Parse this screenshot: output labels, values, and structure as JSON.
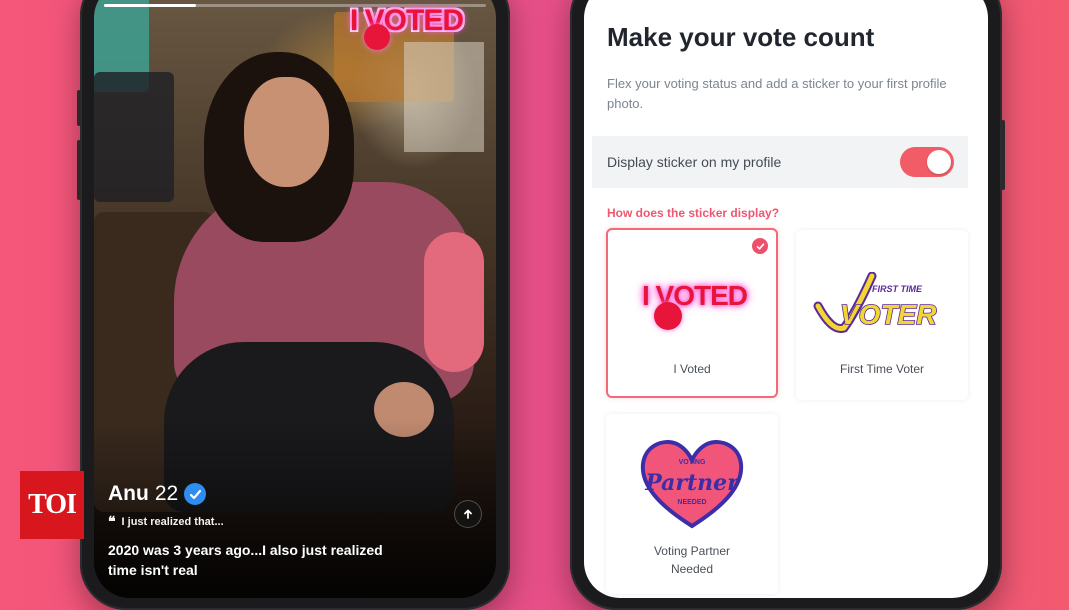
{
  "profile": {
    "name": "Anu",
    "age": "22",
    "quote_prompt": "I just realized that...",
    "bio": "2020 was 3 years ago...I also just realized time isn't real",
    "sticker_text": "I VOTED",
    "story_progress": 0.24
  },
  "settings": {
    "title": "Make your vote count",
    "description": "Flex your voting status and add a sticker to your first profile photo.",
    "toggle_label": "Display sticker on my profile",
    "toggle_on": true,
    "help_link": "How does the sticker display?",
    "stickers": [
      {
        "label": "I Voted",
        "art_text": "I VOTED",
        "selected": true
      },
      {
        "label": "First Time Voter",
        "art_text_small": "FIRST TIME",
        "art_text": "VOTER",
        "selected": false
      },
      {
        "label": "Voting Partner Needed",
        "art_text_top": "VOTING",
        "art_text": "Partner",
        "art_text_bottom": "NEEDED",
        "selected": false
      }
    ]
  },
  "watermark": {
    "text": "TOI"
  },
  "colors": {
    "accent": "#f25c67",
    "link": "#f0566f",
    "verified": "#2f8cf0",
    "sticker_red": "#e8153a",
    "sticker_glow": "#ff6fe0",
    "toi_red": "#d7161e"
  },
  "icons": [
    "verified-badge-icon",
    "quote-icon",
    "info-arrow-icon",
    "check-icon"
  ]
}
